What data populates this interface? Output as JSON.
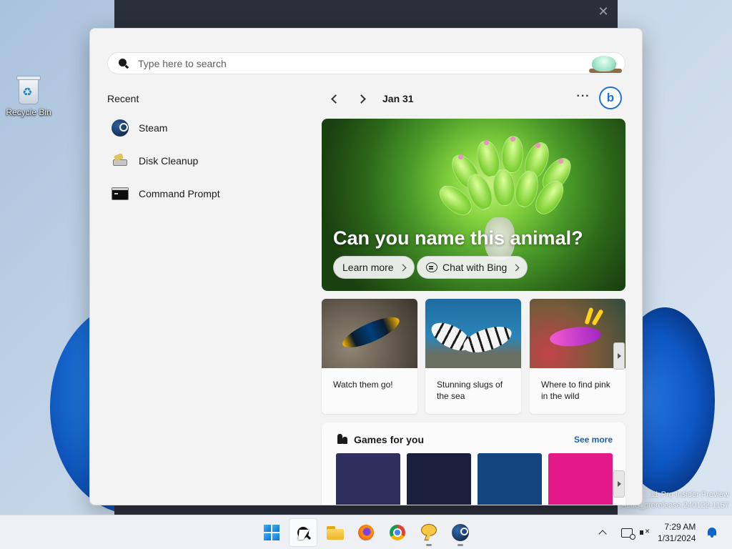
{
  "desktop": {
    "recycle_bin_label": "Recycle Bin",
    "watermark_line1": "11 Pro Insider Preview",
    "watermark_line2": "ActiS_prerelease.240122-1157"
  },
  "widgets": {
    "search": {
      "placeholder": "Type here to search"
    },
    "recent": {
      "title": "Recent",
      "items": [
        {
          "label": "Steam",
          "icon": "steam-icon"
        },
        {
          "label": "Disk Cleanup",
          "icon": "disk-cleanup-icon"
        },
        {
          "label": "Command Prompt",
          "icon": "command-prompt-icon"
        }
      ]
    },
    "date": "Jan 31",
    "more_label": "···",
    "bing_label": "b",
    "hero": {
      "title": "Can you name this animal?",
      "learn_more": "Learn more",
      "chat_with_bing": "Chat with Bing"
    },
    "cards": [
      {
        "caption": "Watch them go!"
      },
      {
        "caption": "Stunning slugs of the sea"
      },
      {
        "caption": "Where to find pink in the wild"
      }
    ],
    "games": {
      "title": "Games for you",
      "see_more": "See more",
      "tile_colors": [
        "#2f2f5e",
        "#1a1f3d",
        "#14447f",
        "#e3198a"
      ]
    }
  },
  "taskbar": {
    "apps": [
      "start",
      "search",
      "file-explorer",
      "firefox",
      "chrome",
      "tips",
      "steam"
    ],
    "clock": {
      "time": "7:29 AM",
      "date": "1/31/2024"
    }
  },
  "colors": {
    "accent": "#1a5fb4",
    "bing": "#2471d6"
  }
}
